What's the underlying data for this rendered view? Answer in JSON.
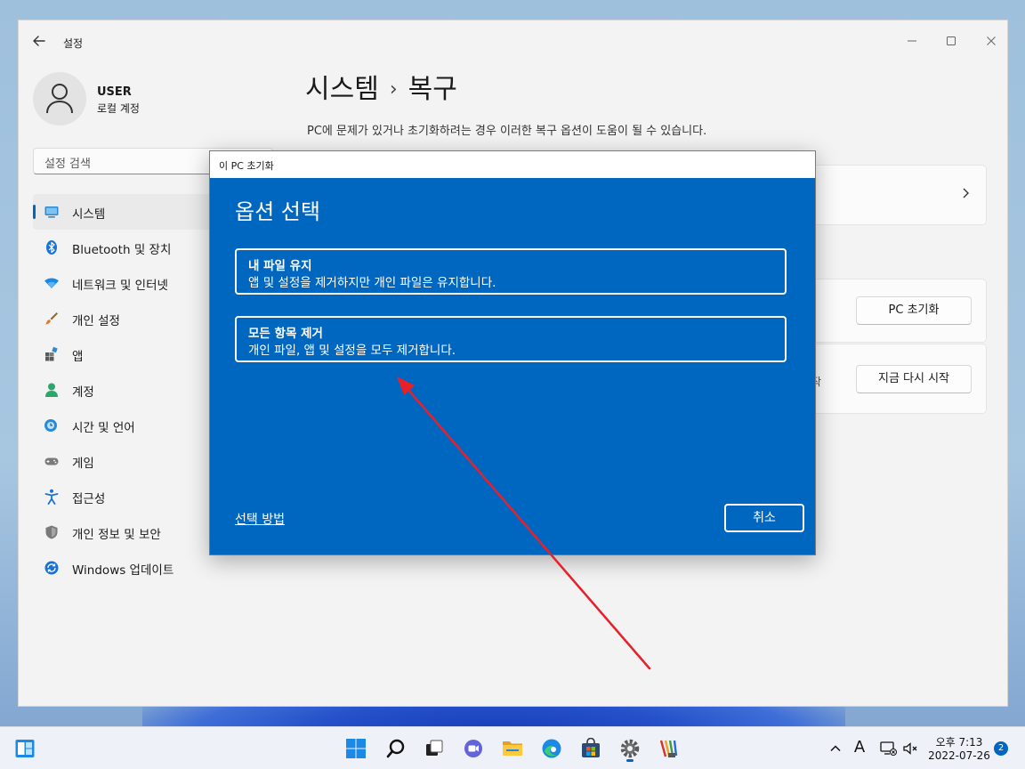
{
  "window": {
    "title": "설정",
    "back_icon": "arrow-left-icon",
    "controls": [
      "minimize-icon",
      "maximize-icon",
      "close-icon"
    ]
  },
  "profile": {
    "name": "USER",
    "account_type": "로컬 계정"
  },
  "search": {
    "placeholder": "설정 검색"
  },
  "sidebar": {
    "selected": "시스템",
    "items": [
      {
        "label": "시스템",
        "icon": "monitor-icon"
      },
      {
        "label": "Bluetooth 및 장치",
        "icon": "bluetooth-icon"
      },
      {
        "label": "네트워크 및 인터넷",
        "icon": "wifi-icon"
      },
      {
        "label": "개인 설정",
        "icon": "brush-icon"
      },
      {
        "label": "앱",
        "icon": "apps-icon"
      },
      {
        "label": "계정",
        "icon": "person-icon"
      },
      {
        "label": "시간 및 언어",
        "icon": "globe-clock-icon"
      },
      {
        "label": "게임",
        "icon": "gamepad-icon"
      },
      {
        "label": "접근성",
        "icon": "accessibility-icon"
      },
      {
        "label": "개인 정보 및 보안",
        "icon": "shield-icon"
      },
      {
        "label": "Windows 업데이트",
        "icon": "update-icon"
      }
    ]
  },
  "page": {
    "breadcrumb_parent": "시스템",
    "breadcrumb_separator": "›",
    "breadcrumb_current": "복구",
    "description": "PC에 문제가 있거나 초기화하려는 경우 이러한 복구 옵션이 도움이 될 수 있습니다."
  },
  "recovery_cards": {
    "reset_button": "PC 초기화",
    "restart_button": "지금 다시 시작",
    "restart_fragment": "작"
  },
  "dialog": {
    "window_title": "이 PC 초기화",
    "heading": "옵션 선택",
    "options": [
      {
        "title": "내 파일 유지",
        "description": "앱 및 설정을 제거하지만 개인 파일은 유지합니다."
      },
      {
        "title": "모든 항목 제거",
        "description": "개인 파일, 앱 및 설정을 모두 제거합니다."
      }
    ],
    "help_link": "선택 방법",
    "cancel_button": "취소"
  },
  "annotation": {
    "arrow_color": "#e8202a"
  },
  "colors": {
    "accent": "#0067c0",
    "dialog_background": "#0067c0"
  },
  "taskbar": {
    "apps": [
      "widgets-icon",
      "start-icon",
      "search-icon",
      "task-view-icon",
      "chat-icon",
      "file-explorer-icon",
      "edge-icon",
      "store-icon",
      "settings-icon",
      "paint-icon"
    ],
    "active_app": "settings-icon",
    "tray": [
      "chevron-up-icon",
      "ime-icon",
      "network-icon",
      "volume-muted-icon"
    ],
    "ime_label": "A",
    "time": "오후 7:13",
    "date": "2022-07-26",
    "notification_count": "2"
  }
}
